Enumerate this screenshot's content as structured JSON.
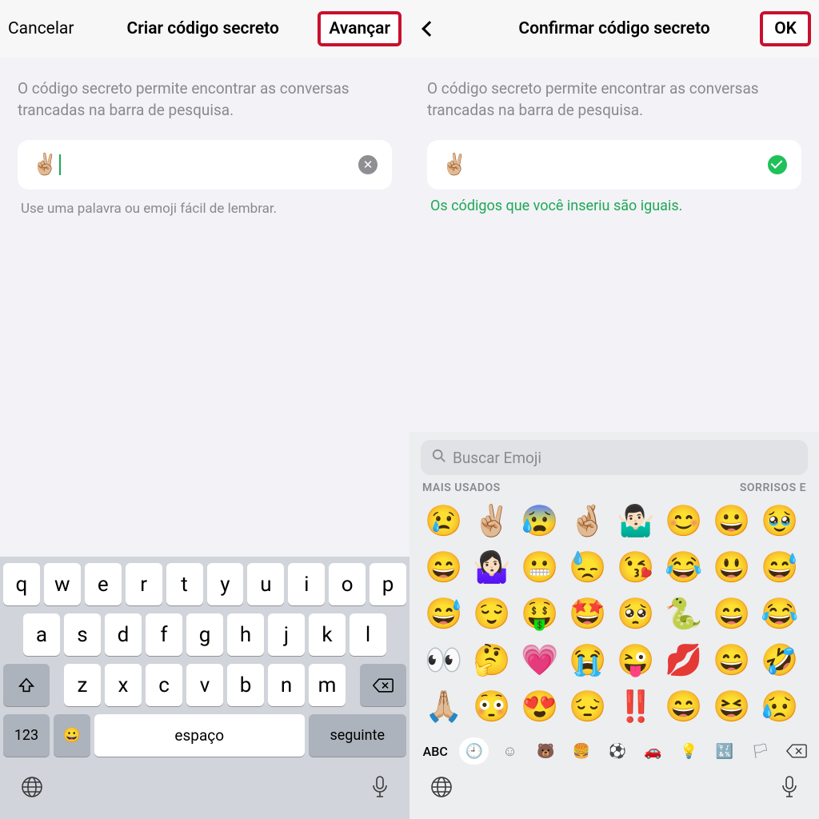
{
  "left": {
    "header": {
      "cancel": "Cancelar",
      "title": "Criar código secreto",
      "next": "Avançar"
    },
    "desc": "O código secreto permite encontrar as conversas trancadas na barra de pesquisa.",
    "input_value": "✌🏼",
    "helper": "Use uma palavra ou emoji fácil de lembrar.",
    "keyboard": {
      "row1": [
        "q",
        "w",
        "e",
        "r",
        "t",
        "y",
        "u",
        "i",
        "o",
        "p"
      ],
      "row2": [
        "a",
        "s",
        "d",
        "f",
        "g",
        "h",
        "j",
        "k",
        "l"
      ],
      "row3": [
        "z",
        "x",
        "c",
        "v",
        "b",
        "n",
        "m"
      ],
      "k123": "123",
      "space": "espaço",
      "next": "seguinte"
    }
  },
  "right": {
    "header": {
      "title": "Confirmar código secreto",
      "ok": "OK"
    },
    "desc": "O código secreto permite encontrar as conversas trancadas na barra de pesquisa.",
    "input_value": "✌🏼",
    "success_msg": "Os códigos que você inseriu são iguais.",
    "emoji": {
      "search_ph": "Buscar Emoji",
      "cat1": "MAIS USADOS",
      "cat2": "SORRISOS E",
      "grid": [
        "😢",
        "✌🏼",
        "😰",
        "🤞🏼",
        "🤷🏻‍♂️",
        "😊",
        "😀",
        "🥹",
        "😄",
        "🤷🏻‍♀️",
        "😬",
        "😓",
        "😘",
        "😂",
        "😃",
        "😅",
        "😅",
        "😌",
        "🤑",
        "🤩",
        "🥺",
        "🐍",
        "😄",
        "😂",
        "👀",
        "🤔",
        "💗",
        "😭",
        "😜",
        "💋",
        "😄",
        "🤣",
        "🙏🏼",
        "😳",
        "😍",
        "😔",
        "‼️",
        "😄",
        "😆",
        "😥"
      ],
      "abc": "ABC"
    }
  }
}
